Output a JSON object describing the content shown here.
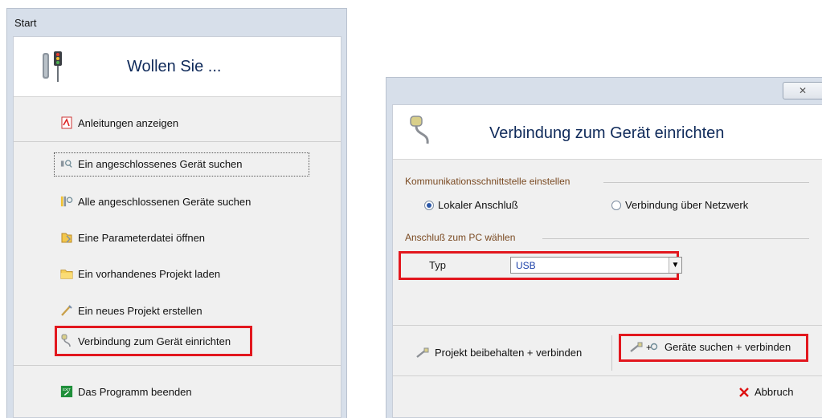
{
  "left_window": {
    "title": "Start",
    "header_title": "Wollen Sie ...",
    "items": [
      {
        "label": "Anleitungen anzeigen",
        "icon": "pdf-icon"
      },
      {
        "label": "Ein angeschlossenes Gerät suchen",
        "icon": "device-search-icon"
      },
      {
        "label": "Alle angeschlossenen Geräte suchen",
        "icon": "devices-search-icon"
      },
      {
        "label": "Eine Parameterdatei öffnen",
        "icon": "open-file-icon"
      },
      {
        "label": "Ein vorhandenes Projekt laden",
        "icon": "folder-icon"
      },
      {
        "label": "Ein neues Projekt erstellen",
        "icon": "new-project-icon"
      },
      {
        "label": "Verbindung zum Gerät einrichten",
        "icon": "connection-icon"
      },
      {
        "label": "Das Programm beenden",
        "icon": "exit-icon"
      }
    ]
  },
  "right_window": {
    "close_label": "✕",
    "header_title": "Verbindung zum Gerät einrichten",
    "interface_group": "Kommunikationsschnittstelle einstellen",
    "radio_local": "Lokaler Anschluß",
    "radio_network": "Verbindung über Netzwerk",
    "port_group": "Anschluß zum PC wählen",
    "type_label": "Typ",
    "type_value": "USB",
    "btn_keep_project": "Projekt beibehalten + verbinden",
    "btn_search_devices": "Geräte suchen + verbinden",
    "btn_cancel": "Abbruch"
  },
  "colors": {
    "highlight": "#e2171e",
    "title": "#0f2a5a"
  }
}
